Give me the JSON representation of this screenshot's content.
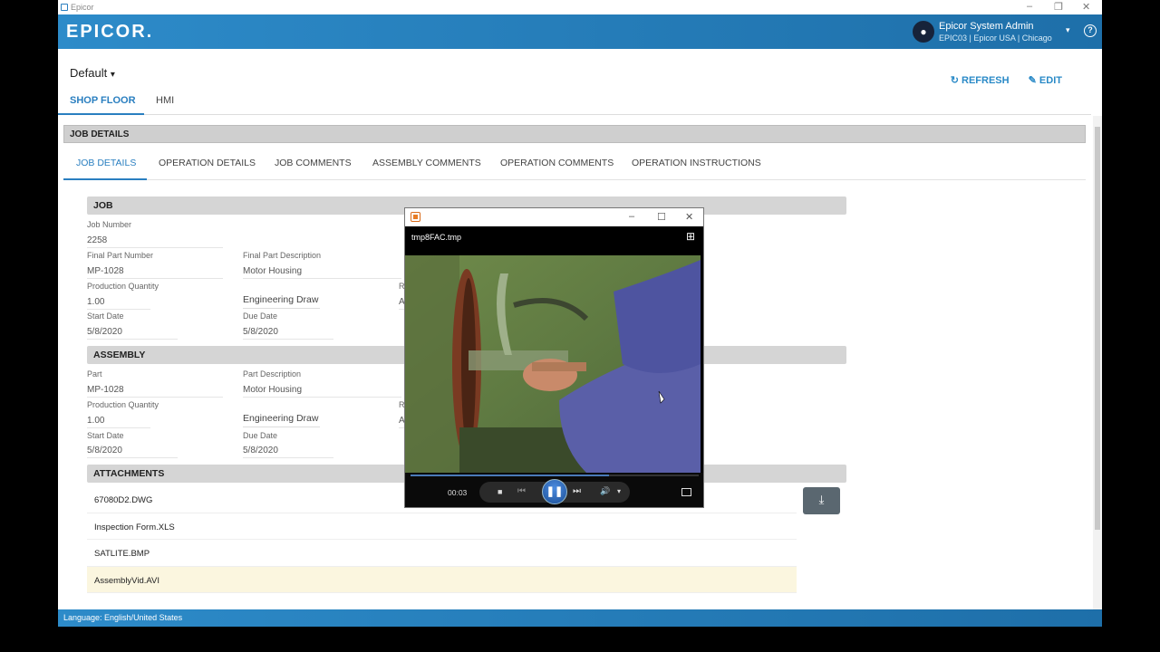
{
  "window": {
    "title": "Epicor",
    "minimize": "–",
    "restore": "❐",
    "close": "✕"
  },
  "header": {
    "logo": "EPICOR.",
    "user_name": "Epicor System Admin",
    "user_context": "EPIC03 | Epicor USA | Chicago",
    "avatar_glyph": "●",
    "dropdown_glyph": "▾",
    "help_glyph": "?"
  },
  "layout": {
    "name": "Default",
    "caret": "▾"
  },
  "actions": {
    "refresh": "↻ REFRESH",
    "edit": "✎ EDIT"
  },
  "top_tabs": [
    "SHOP FLOOR",
    "HMI"
  ],
  "job_details_header": "JOB DETAILS",
  "sub_tabs": [
    "JOB DETAILS",
    "OPERATION DETAILS",
    "JOB COMMENTS",
    "ASSEMBLY COMMENTS",
    "OPERATION COMMENTS",
    "OPERATION INSTRUCTIONS"
  ],
  "job": {
    "section": "JOB",
    "job_number_label": "Job Number",
    "job_number": "2258",
    "final_part_label": "Final Part Number",
    "final_part": "MP-1028",
    "final_desc_label": "Final Part Description",
    "final_desc": "Motor Housing",
    "prod_qty_label": "Production Quantity",
    "prod_qty": "1.00",
    "eng_draw": "Engineering Draw",
    "r_label": "R",
    "a_val": "A",
    "start_label": "Start Date",
    "start": "5/8/2020",
    "due_label": "Due Date",
    "due": "5/8/2020"
  },
  "assembly": {
    "section": "ASSEMBLY",
    "part_label": "Part",
    "part": "MP-1028",
    "desc_label": "Part Description",
    "desc": "Motor Housing",
    "prod_qty_label": "Production Quantity",
    "prod_qty": "1.00",
    "eng_draw": "Engineering Draw",
    "r_label": "R",
    "a_val": "A",
    "start_label": "Start Date",
    "start": "5/8/2020",
    "due_label": "Due Date",
    "due": "5/8/2020"
  },
  "attachments": {
    "section": "ATTACHMENTS",
    "files": [
      "67080D2.DWG",
      "Inspection Form.XLS",
      "SATLITE.BMP",
      "AssemblyVid.AVI"
    ],
    "download_glyph": "⤓"
  },
  "status_bar": {
    "language": "Language: English/United States"
  },
  "media_player": {
    "file_name": "tmp8FAC.tmp",
    "time": "00:03",
    "progress": 0.69,
    "minimize": "–",
    "maximize": "☐",
    "close": "✕",
    "grid_glyph": "⊞",
    "stop_glyph": "■",
    "prev_glyph": "⏮",
    "pause_glyph": "❚❚",
    "next_glyph": "⏭",
    "volume_glyph": "🔊",
    "vol_caret": "▾"
  },
  "colors": {
    "accent": "#2a7fc0",
    "header": "#2d8bc9",
    "selected_row": "#fbf6df"
  }
}
